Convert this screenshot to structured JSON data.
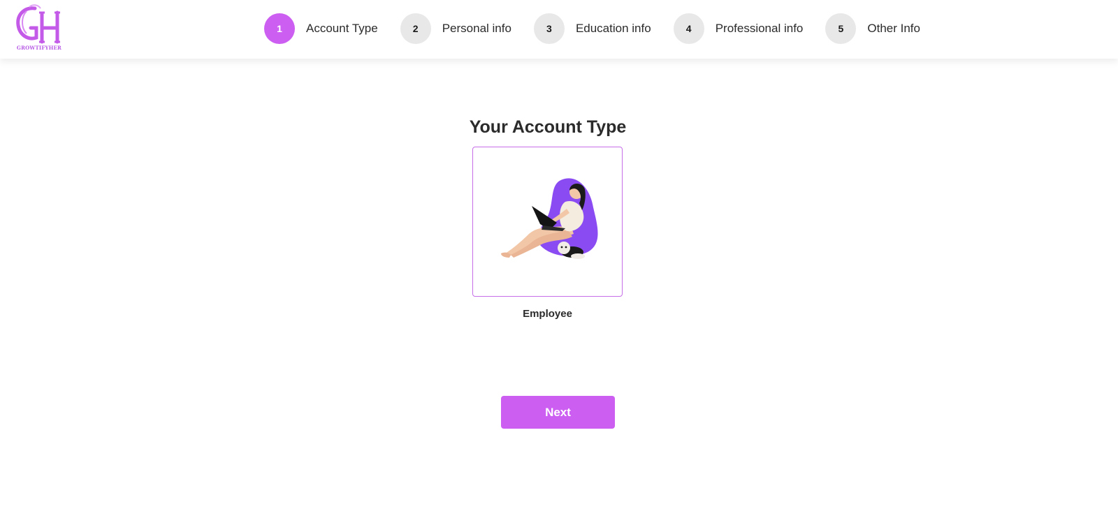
{
  "brand": {
    "logo_text": "GROWTIFYHER",
    "logo_icon": "gh-monogram-logo",
    "accent_color": "#cc5ef2"
  },
  "stepper": {
    "steps": [
      {
        "number": "1",
        "label": "Account Type",
        "active": true
      },
      {
        "number": "2",
        "label": "Personal info",
        "active": false
      },
      {
        "number": "3",
        "label": "Education info",
        "active": false
      },
      {
        "number": "4",
        "label": "Professional info",
        "active": false
      },
      {
        "number": "5",
        "label": "Other Info",
        "active": false
      }
    ]
  },
  "main": {
    "title": "Your Account Type",
    "account_option": {
      "label": "Employee",
      "illustration": "woman-on-beanbag-with-laptop-illustration",
      "selected": true
    },
    "next_label": "Next"
  }
}
